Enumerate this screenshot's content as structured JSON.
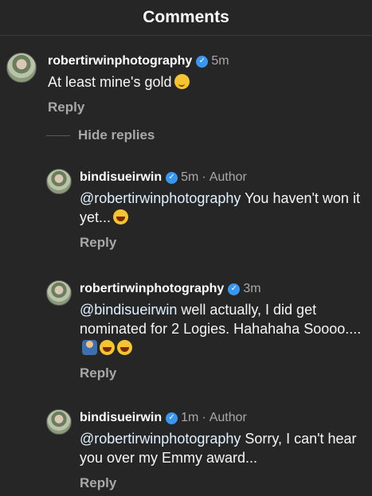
{
  "header": {
    "title": "Comments"
  },
  "comments": [
    {
      "username": "robertirwinphotography",
      "time": "5m",
      "text": "At least mine's gold",
      "emoji": "smirking-face",
      "reply_label": "Reply"
    }
  ],
  "thread": {
    "hide_label": "Hide replies",
    "replies": [
      {
        "username": "bindisueirwin",
        "time": "5m",
        "author_label": "Author",
        "mention": "@robertirwinphotography",
        "text": " You haven't won it yet...",
        "emojis": [
          "tears-of-joy"
        ],
        "reply_label": "Reply"
      },
      {
        "username": "robertirwinphotography",
        "time": "3m",
        "mention": "@bindisueirwin",
        "text": " well actually, I did get nominated for 2 Logies. Hahahaha Soooo....",
        "emojis": [
          "person-shrugging",
          "tears-of-joy",
          "tears-of-joy"
        ],
        "reply_label": "Reply"
      },
      {
        "username": "bindisueirwin",
        "time": "1m",
        "author_label": "Author",
        "mention": "@robertirwinphotography",
        "text": " Sorry, I can't hear you over my Emmy award...",
        "emojis": [],
        "reply_label": "Reply"
      }
    ]
  },
  "colors": {
    "background": "#262626",
    "verified": "#3897f0",
    "secondary_text": "#a8a8a8",
    "mention": "#e0f1ff"
  }
}
